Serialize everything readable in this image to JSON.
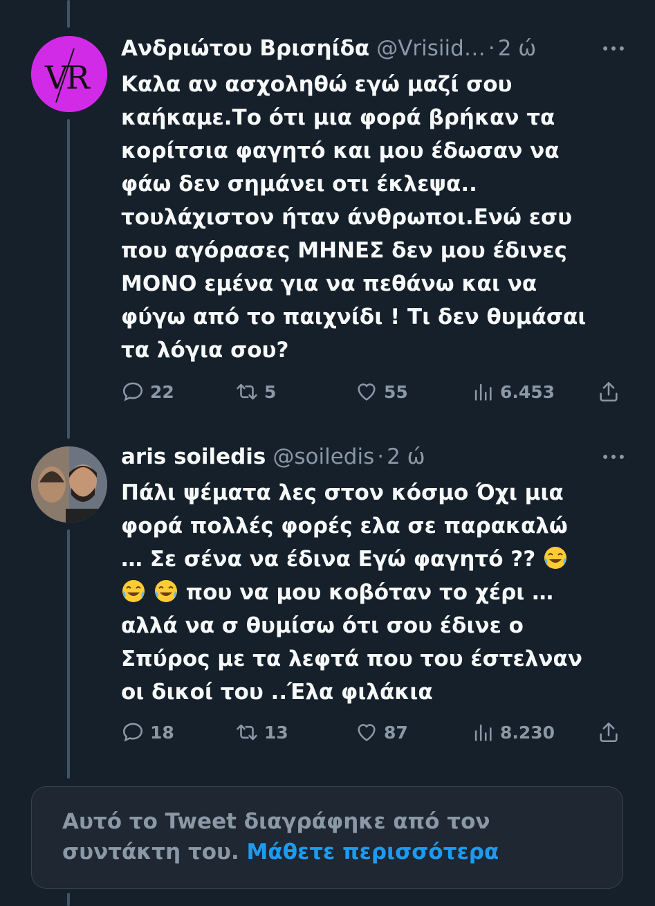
{
  "tweets": [
    {
      "display_name": "Ανδριώτου Βρισηίδα",
      "handle": "@Vrisiid…",
      "separator": "·",
      "time": "2 ώ",
      "avatar_initials": "VR",
      "text": "Καλα αν ασχοληθώ εγώ μαζί σου\nκαήκαμε.Το ότι μια φορά βρήκαν τα\nκορίτσια φαγητό και μου έδωσαν να\nφάω δεν σημάνει οτι έκλεψα..\nτουλάχιστον ήταν άνθρωποι.Ενώ εσυ\nπου αγόρασες ΜΗΝΕΣ δεν μου έδινες\nΜΟΝΟ εμένα  για να πεθάνω και να\nφύγω από το παιχνίδι ! Τι δεν θυμάσαι\nτα λόγια σου?",
      "replies": "22",
      "retweets": "5",
      "likes": "55",
      "views": "6.453"
    },
    {
      "display_name": "aris soiledis",
      "handle": "@soiledis",
      "separator": "·",
      "time": "2 ώ",
      "text_line1": "Πάλι ψέματα λες στον κόσμο Όχι μια",
      "text_line2": "φορά πολλές φορές ελα σε παρακαλώ",
      "text_line3": "… Σε σένα να έδινα Εγώ φαγητό ??",
      "text_line4": "που να μου κοβόταν το χέρι …",
      "text_rest": "αλλά να σ θυμίσω ότι σου έδινε ο\nΣπύρος με τα λεφτά που του έστελναν\nοι δικοί του ..Έλα φιλάκια",
      "emoji_name": "face-with-tears-of-joy",
      "replies": "18",
      "retweets": "13",
      "likes": "87",
      "views": "8.230"
    }
  ],
  "deleted_notice": {
    "text": "Αυτό το Tweet διαγράφηκε από τον συντάκτη του.",
    "link": "Μάθετε περισσότερα"
  },
  "colors": {
    "background": "#15202b",
    "text_primary": "#f7f9f9",
    "text_secondary": "#8b98a5",
    "accent": "#1d9bf0",
    "thread_line": "#425464",
    "avatar_bg": "#d22be8"
  },
  "icons": [
    "reply-icon",
    "retweet-icon",
    "like-icon",
    "views-icon",
    "share-icon",
    "more-icon"
  ]
}
